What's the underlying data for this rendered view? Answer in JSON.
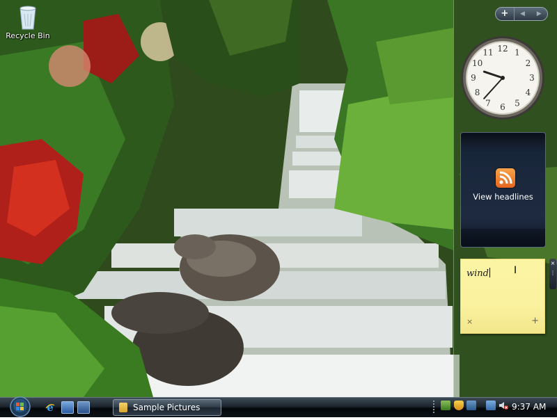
{
  "desktop": {
    "icons": [
      {
        "label": "Recycle Bin",
        "icon": "recycle-bin-icon"
      }
    ]
  },
  "sidebar": {
    "controls": {
      "add": "+",
      "prev": "◀",
      "next": "▶"
    },
    "clock": {
      "hour": 9,
      "minute": 37
    },
    "feed": {
      "label": "View headlines",
      "icon": "rss-feed-icon"
    },
    "notes": {
      "text": "wind",
      "delete": "×",
      "add": "+"
    },
    "notes_tools": {
      "close": "×",
      "drag": "⋮"
    }
  },
  "taskbar": {
    "start_icon": "windows-start-orb-icon",
    "quick_launch": [
      {
        "name": "internet-explorer-icon",
        "color": "#2a7ad6"
      },
      {
        "name": "show-desktop-icon",
        "color": "#4a78b8"
      },
      {
        "name": "switch-windows-icon",
        "color": "#5a80b0"
      }
    ],
    "tasks": [
      {
        "label": "Sample Pictures",
        "icon": "folder-icon"
      }
    ],
    "tray": {
      "icons": [
        "windows-defender-icon",
        "shield-icon",
        "network-icon",
        "display-icon",
        "volume-muted-icon"
      ],
      "clock": "9:37 AM"
    }
  },
  "colors": {
    "taskbar": "#0c1218",
    "feed_accent": "#e6651e",
    "note": "#fbf4a2"
  }
}
